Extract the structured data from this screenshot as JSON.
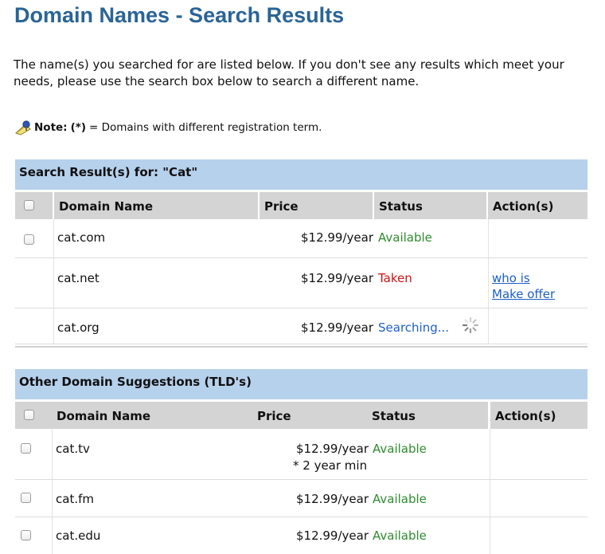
{
  "page": {
    "title": "Domain Names - Search Results",
    "intro": "The name(s) you searched for are listed below. If you don't see any results which meet your needs, please use the search box below to search a different name."
  },
  "note": {
    "icon": "pushpin-note-icon",
    "label": "Note:",
    "star": "(*)",
    "text": "= Domains with different registration term."
  },
  "columns": {
    "domain": "Domain Name",
    "price": "Price",
    "status": "Status",
    "actions": "Action(s)"
  },
  "search_results": {
    "heading": "Search Result(s) for: \"Cat\"",
    "rows": [
      {
        "domain": "cat.com",
        "price": "$12.99/year",
        "status": "Available",
        "status_kind": "available"
      },
      {
        "domain": "cat.net",
        "price": "$12.99/year",
        "status": "Taken",
        "status_kind": "taken",
        "action_1": "who is",
        "action_2": "Make offer"
      },
      {
        "domain": "cat.org",
        "price": "$12.99/year",
        "status": "Searching...",
        "status_kind": "searching"
      }
    ]
  },
  "suggestions": {
    "heading": "Other Domain Suggestions (TLD's)",
    "rows": [
      {
        "domain": "cat.tv",
        "price": "$12.99/year",
        "note": "* 2 year min",
        "status": "Available",
        "status_kind": "available"
      },
      {
        "domain": "cat.fm",
        "price": "$12.99/year",
        "status": "Available",
        "status_kind": "available"
      },
      {
        "domain": "cat.edu",
        "price": "$12.99/year",
        "status": "Available",
        "status_kind": "available"
      }
    ]
  },
  "colors": {
    "title": "#2a6496",
    "section_header_bg": "#b6d1ec",
    "column_header_bg": "#d4d4d4",
    "available": "#2e8b2e",
    "taken": "#cc1111",
    "link": "#1d5fc6"
  }
}
